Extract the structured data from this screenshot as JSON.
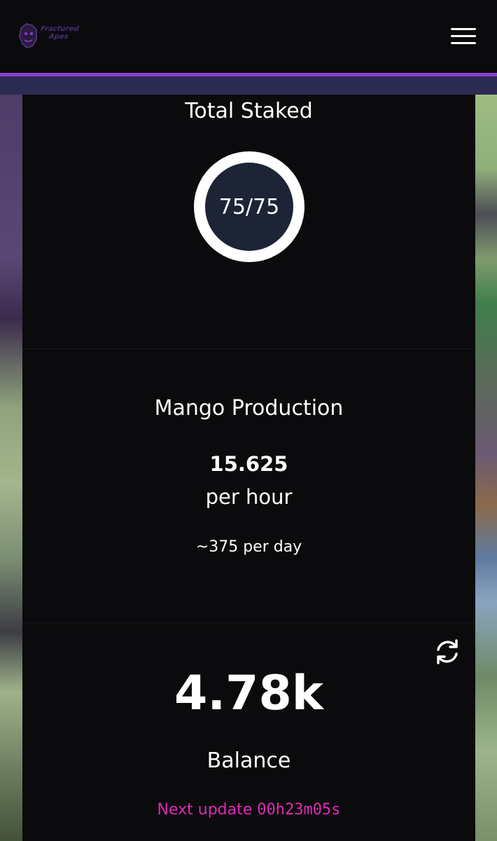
{
  "header": {
    "logo_text": "Fractured Apes",
    "menu_icon": "hamburger-menu-icon"
  },
  "total_staked": {
    "title": "Total Staked",
    "value": "75/75",
    "fraction": 1.0
  },
  "mango_production": {
    "title": "Mango Production",
    "rate": "15.625",
    "rate_unit": "per hour",
    "per_day": "~375 per day"
  },
  "balance": {
    "value": "4.78k",
    "label": "Balance",
    "next_update_label": "Next update",
    "next_update_time": "00h23m05s",
    "refresh_icon": "refresh-icon"
  },
  "colors": {
    "accent_purple": "#8b3fd6",
    "subbar": "#2c2b52",
    "panel_bg": "#0b0b0d",
    "ring_inner": "#1d2436",
    "countdown": "#e02ab8"
  }
}
